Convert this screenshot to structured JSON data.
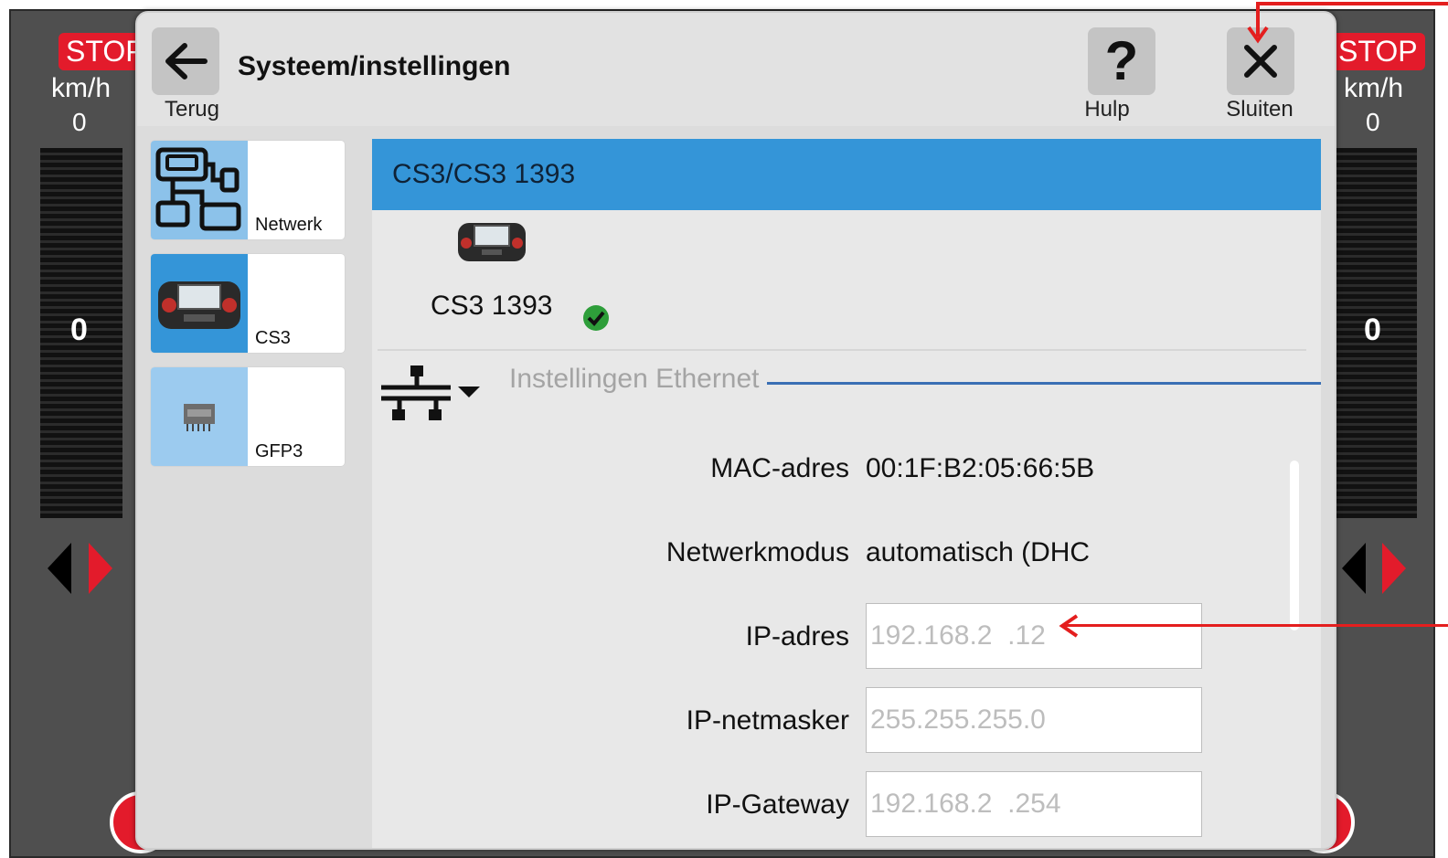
{
  "background": {
    "left": {
      "stop_label": "STOP",
      "speed_unit": "km/h",
      "speed_value": "0",
      "gauge_value": "0"
    },
    "right": {
      "stop_label": "STOP",
      "speed_unit": "km/h",
      "speed_value": "0",
      "gauge_value": "0"
    }
  },
  "header": {
    "title": "Systeem/instellingen",
    "back_label": "Terug",
    "help_label": "Hulp",
    "close_label": "Sluiten"
  },
  "nav": {
    "items": [
      {
        "label": "Netwerk",
        "icon": "network-icon"
      },
      {
        "label": "CS3",
        "icon": "cs3-device-icon"
      },
      {
        "label": "GFP3",
        "icon": "chip-icon"
      }
    ]
  },
  "device": {
    "header": "CS3/CS3 1393",
    "name": "CS3 1393",
    "status_icon": "check-icon"
  },
  "ethernet": {
    "title": "Instellingen Ethernet",
    "fields": {
      "mac_label": "MAC-adres",
      "mac_value": "00:1F:B2:05:66:5B",
      "mode_label": "Netwerkmodus",
      "mode_value": "automatisch (DHC",
      "ip_label": "IP-adres",
      "ip_value": "192.168.2  .12",
      "mask_label": "IP-netmasker",
      "mask_value": "255.255.255.0",
      "gateway_label": "IP-Gateway",
      "gateway_value": "192.168.2  .254"
    }
  },
  "colors": {
    "accent_blue": "#3495d8",
    "stop_red": "#e31b2b",
    "annotation_red": "#e41e1e",
    "status_green": "#2e9e3a"
  }
}
